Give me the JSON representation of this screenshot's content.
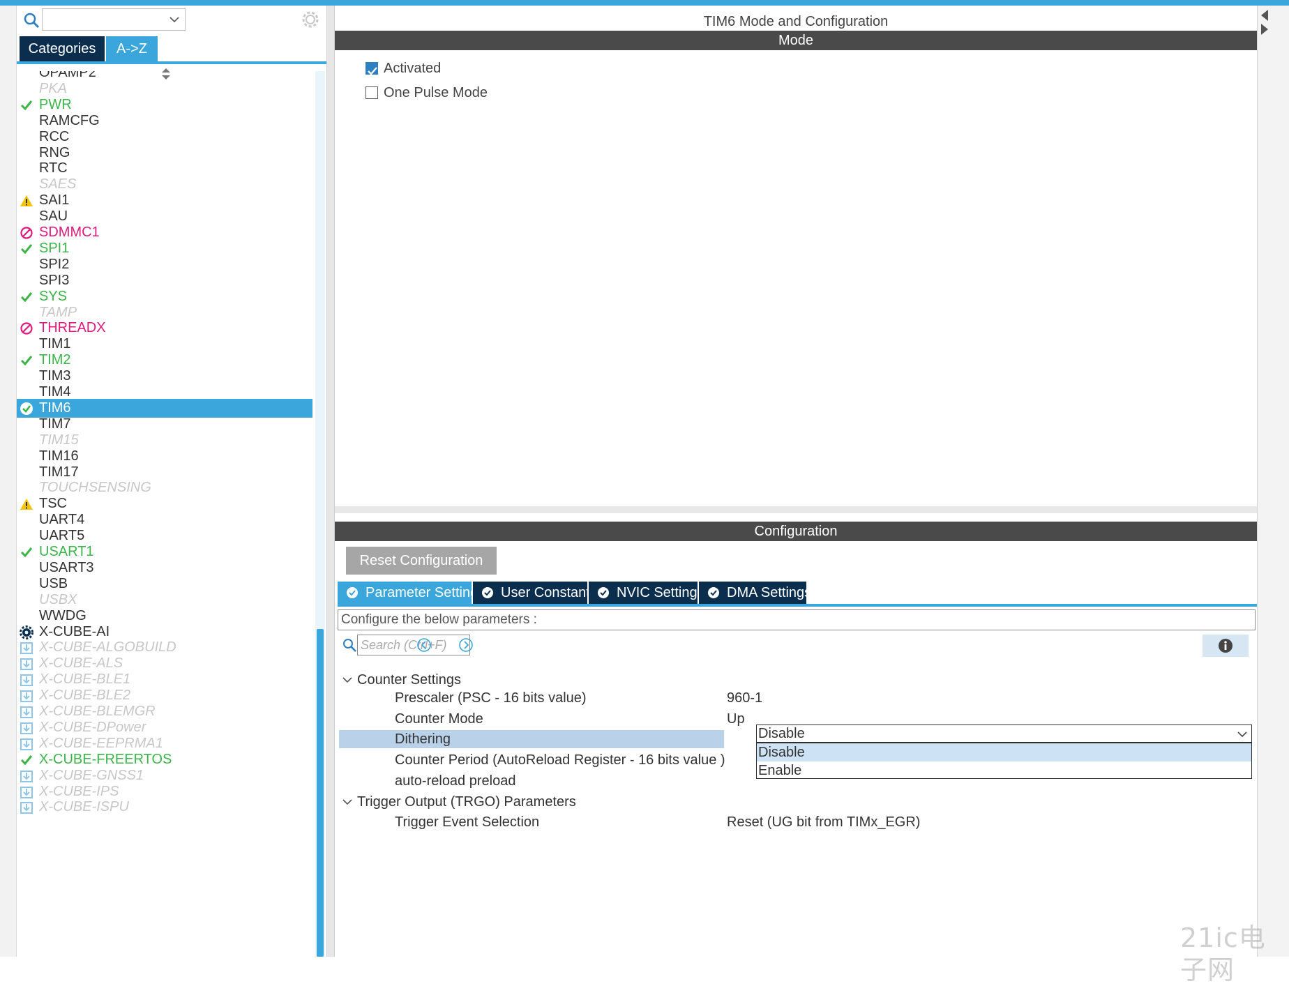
{
  "left_panel": {
    "search": {
      "value": ""
    },
    "tabs": [
      {
        "label": "Categories"
      },
      {
        "label": "A->Z"
      }
    ],
    "items": [
      {
        "label": "OPAMP2",
        "status": "normal"
      },
      {
        "label": "PKA",
        "status": "disabled"
      },
      {
        "label": "PWR",
        "status": "ok"
      },
      {
        "label": "RAMCFG",
        "status": "normal"
      },
      {
        "label": "RCC",
        "status": "normal"
      },
      {
        "label": "RNG",
        "status": "normal"
      },
      {
        "label": "RTC",
        "status": "normal"
      },
      {
        "label": "SAES",
        "status": "disabled"
      },
      {
        "label": "SAI1",
        "status": "warning"
      },
      {
        "label": "SAU",
        "status": "normal"
      },
      {
        "label": "SDMMC1",
        "status": "error"
      },
      {
        "label": "SPI1",
        "status": "ok"
      },
      {
        "label": "SPI2",
        "status": "normal"
      },
      {
        "label": "SPI3",
        "status": "normal"
      },
      {
        "label": "SYS",
        "status": "ok"
      },
      {
        "label": "TAMP",
        "status": "disabled"
      },
      {
        "label": "THREADX",
        "status": "error"
      },
      {
        "label": "TIM1",
        "status": "normal"
      },
      {
        "label": "TIM2",
        "status": "ok"
      },
      {
        "label": "TIM3",
        "status": "normal"
      },
      {
        "label": "TIM4",
        "status": "normal"
      },
      {
        "label": "TIM6",
        "status": "selected"
      },
      {
        "label": "TIM7",
        "status": "normal"
      },
      {
        "label": "TIM15",
        "status": "disabled"
      },
      {
        "label": "TIM16",
        "status": "normal"
      },
      {
        "label": "TIM17",
        "status": "normal"
      },
      {
        "label": "TOUCHSENSING",
        "status": "disabled"
      },
      {
        "label": "TSC",
        "status": "warning"
      },
      {
        "label": "UART4",
        "status": "normal"
      },
      {
        "label": "UART5",
        "status": "normal"
      },
      {
        "label": "USART1",
        "status": "ok"
      },
      {
        "label": "USART3",
        "status": "normal"
      },
      {
        "label": "USB",
        "status": "normal"
      },
      {
        "label": "USBX",
        "status": "disabled"
      },
      {
        "label": "WWDG",
        "status": "normal"
      },
      {
        "label": "X-CUBE-AI",
        "status": "package"
      },
      {
        "label": "X-CUBE-ALGOBUILD",
        "status": "download"
      },
      {
        "label": "X-CUBE-ALS",
        "status": "download"
      },
      {
        "label": "X-CUBE-BLE1",
        "status": "download"
      },
      {
        "label": "X-CUBE-BLE2",
        "status": "download"
      },
      {
        "label": "X-CUBE-BLEMGR",
        "status": "download"
      },
      {
        "label": "X-CUBE-DPower",
        "status": "download"
      },
      {
        "label": "X-CUBE-EEPRMA1",
        "status": "download"
      },
      {
        "label": "X-CUBE-FREERTOS",
        "status": "ok"
      },
      {
        "label": "X-CUBE-GNSS1",
        "status": "download"
      },
      {
        "label": "X-CUBE-IPS",
        "status": "download"
      },
      {
        "label": "X-CUBE-ISPU",
        "status": "download"
      }
    ]
  },
  "right_panel": {
    "title": "TIM6 Mode and Configuration",
    "mode_section": {
      "header": "Mode",
      "activated": {
        "label": "Activated",
        "checked": true
      },
      "one_pulse": {
        "label": "One Pulse Mode",
        "checked": false
      }
    },
    "config_section": {
      "header": "Configuration",
      "reset_button": "Reset Configuration",
      "tabs": [
        {
          "label": "Parameter Settings",
          "active": true
        },
        {
          "label": "User Constants",
          "active": false
        },
        {
          "label": "NVIC Settings",
          "active": false
        },
        {
          "label": "DMA Settings",
          "active": false
        }
      ],
      "description": "Configure the below parameters :",
      "search_placeholder": "Search (Ctrl+F)",
      "groups": [
        {
          "label": "Counter Settings",
          "params": [
            {
              "name": "Prescaler (PSC - 16 bits value)",
              "value": "960-1"
            },
            {
              "name": "Counter Mode",
              "value": "Up"
            },
            {
              "name": "Dithering",
              "value": "Disable",
              "highlighted": true
            },
            {
              "name": "Counter Period (AutoReload Register - 16 bits value )",
              "value": ""
            },
            {
              "name": "auto-reload preload",
              "value": ""
            }
          ]
        },
        {
          "label": "Trigger Output (TRGO) Parameters",
          "params": [
            {
              "name": "Trigger Event Selection",
              "value": "Reset (UG bit from TIMx_EGR)"
            }
          ]
        }
      ],
      "dropdown": {
        "selected": "Disable",
        "options": [
          "Disable",
          "Enable"
        ]
      }
    }
  },
  "watermark": "21ic电子网",
  "colors": {
    "accent": "#3aa6db",
    "tab_dark": "#0b2e4f",
    "ok": "#3bb54a",
    "error": "#e0197d",
    "warning": "#f5c400",
    "disabled": "#c7c7c7",
    "section_bar": "#4a4a4a"
  }
}
